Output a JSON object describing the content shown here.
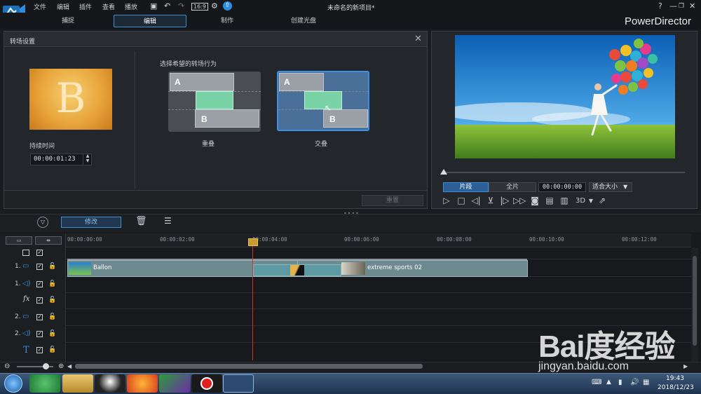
{
  "window": {
    "title": "未命名的新项目*",
    "brand": "PowerDirector",
    "controls": [
      "?",
      "—",
      "❐",
      "✕"
    ]
  },
  "menu": [
    "文件",
    "编辑",
    "插件",
    "查看",
    "播放"
  ],
  "modes": {
    "capture": "捕捉",
    "edit": "编辑",
    "produce": "制作",
    "disc": "创建光盘"
  },
  "transition_panel": {
    "title": "转场设置",
    "duration_label": "持续时间",
    "duration_value": "00:00:01:23",
    "behavior_label": "选择希望的转场行为",
    "option_overlap": "重叠",
    "option_cross": "交叠",
    "letter_a": "A",
    "letter_b": "B",
    "thumb_letter": "B",
    "reset": "重置",
    "selected": "交叠"
  },
  "preview": {
    "segment": "片段",
    "full": "全片",
    "time": "00:00:00:00",
    "fit": "适合大小",
    "three_d": "3D"
  },
  "timeline": {
    "modify": "修改",
    "ticks": [
      "00:00:00:00",
      "00:00:02:00",
      "00:00:04:00",
      "00:00:06:00",
      "00:00:08:00",
      "00:00:10:00",
      "00:00:12:00"
    ],
    "tracks": [
      {
        "num": "",
        "type": "header"
      },
      {
        "num": "1.",
        "type": "video"
      },
      {
        "num": "1.",
        "type": "audio"
      },
      {
        "num": "",
        "type": "fx"
      },
      {
        "num": "2.",
        "type": "video"
      },
      {
        "num": "2.",
        "type": "audio"
      },
      {
        "num": "",
        "type": "title"
      }
    ],
    "clips": {
      "clip1": "Ballon",
      "clip2": "extreme sports 02"
    }
  },
  "taskbar": {
    "time": "19:43",
    "date": "2018/12/23"
  },
  "watermark": {
    "logo": "Bai度经验",
    "url": "jingyan.baidu.com"
  },
  "colors": {
    "accent": "#3a8fd6",
    "playhead": "#d03030",
    "transition_green": "#79d3a6"
  }
}
